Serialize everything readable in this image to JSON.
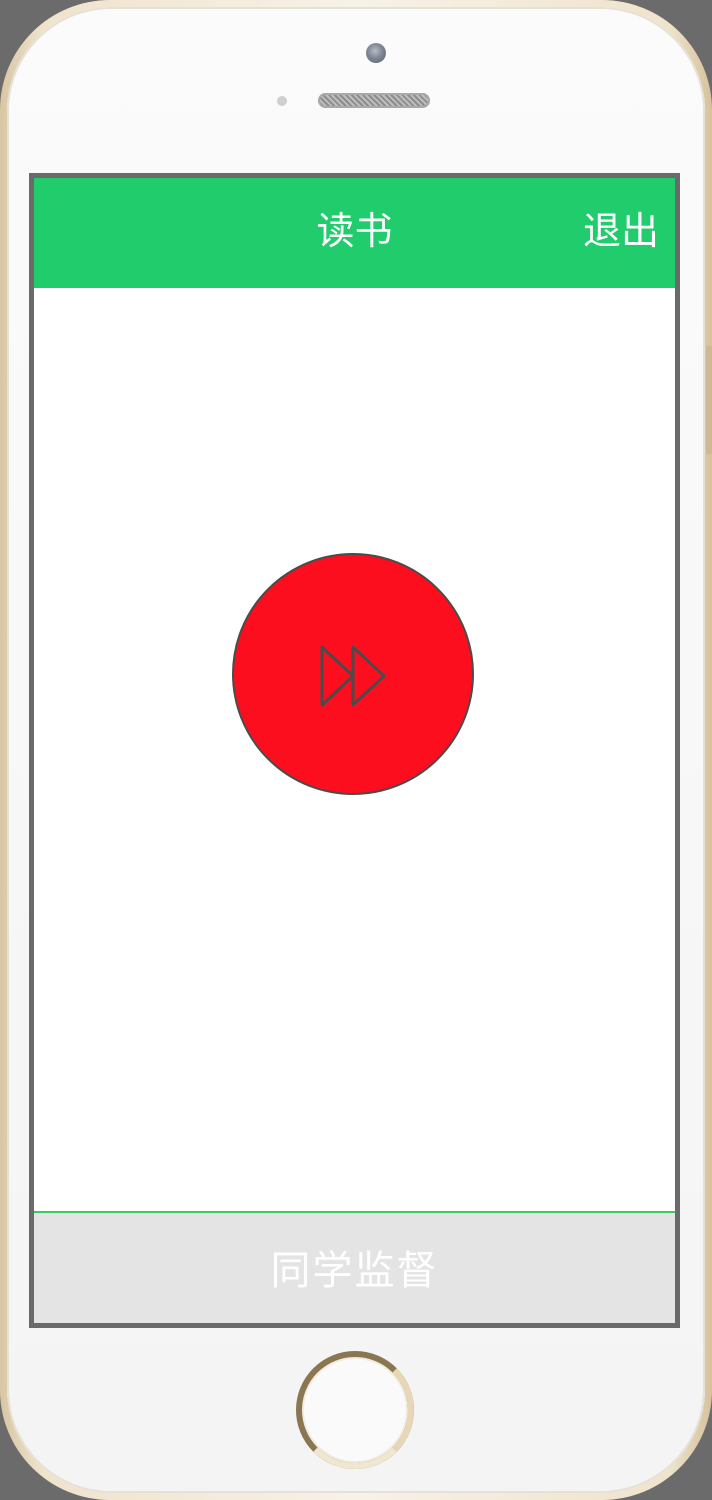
{
  "header": {
    "title": "读书",
    "exit_label": "退出"
  },
  "player": {
    "icon": "fast-forward-icon"
  },
  "footer": {
    "label": "同学监督"
  },
  "colors": {
    "header_bg": "#21cc6d",
    "play_button_bg": "#fc0e1f",
    "footer_bg": "#e4e4e4",
    "footer_divider": "#3fc868"
  }
}
